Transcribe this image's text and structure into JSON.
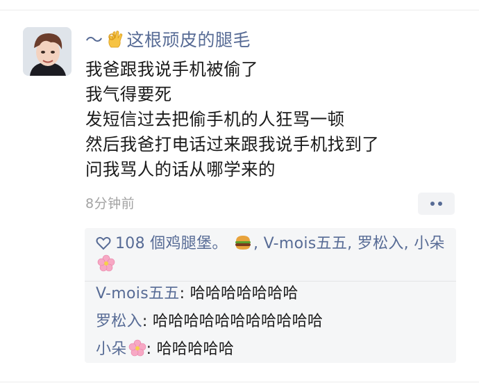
{
  "post": {
    "author_prefix": "～",
    "author_name": "这根顽皮的腿毛",
    "lines": [
      "我爸跟我说手机被偷了",
      "我气得要死",
      "发短信过去把偷手机的人狂骂一顿",
      "然后我爸打电话过来跟我说手机找到了",
      "问我骂人的话从哪学来的"
    ],
    "timestamp": "8分钟前"
  },
  "likes": {
    "count_text": "108 個鸡腿堡。",
    "names": [
      "V-mois五五",
      "罗松入",
      "小朵"
    ],
    "separator": ","
  },
  "comments": [
    {
      "name": "V-mois五五",
      "text": ": 哈哈哈哈哈哈哈"
    },
    {
      "name": "罗松入",
      "text": ": 哈哈哈哈哈哈哈哈哈哈哈"
    },
    {
      "name": "小朵",
      "text": ": 哈哈哈哈哈"
    }
  ],
  "icons": {
    "ok": "ok-hand-icon",
    "heart": "heart-outline-icon",
    "burger": "hamburger-emoji-icon",
    "flower": "cherry-blossom-emoji-icon",
    "more": "more-dots-icon"
  },
  "colors": {
    "link": "#576b95",
    "text": "#1a1a1a",
    "muted": "#a3a3a3",
    "box_bg": "#f5f6f7"
  }
}
